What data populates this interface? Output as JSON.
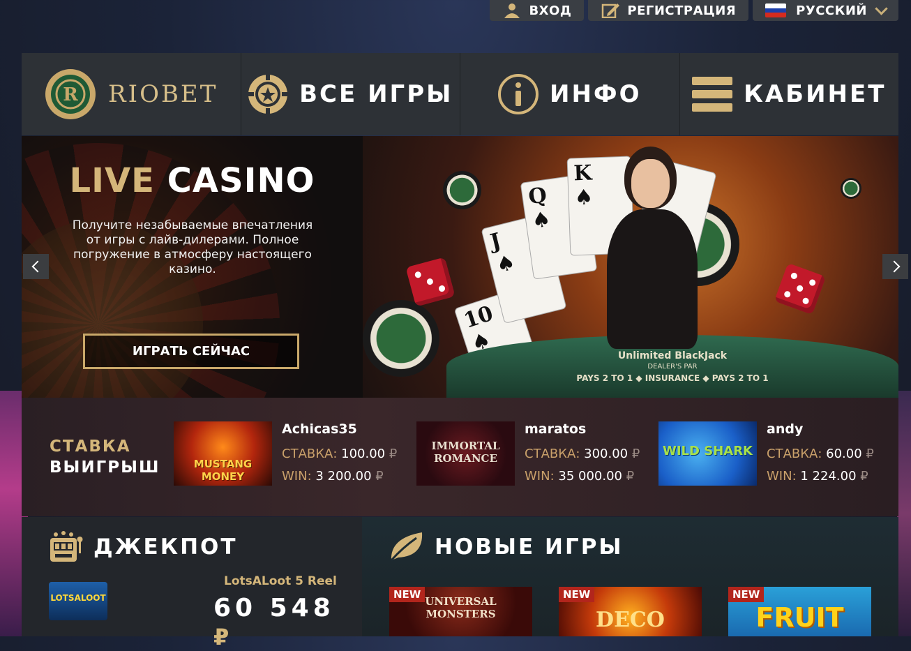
{
  "topbar": {
    "login_label": "ВХОД",
    "register_label": "РЕГИСТРАЦИЯ",
    "language_label": "РУССКИЙ"
  },
  "nav": {
    "logo_text": "RIOBET",
    "items": [
      {
        "label": "ВСЕ ИГРЫ",
        "icon": "chip-icon"
      },
      {
        "label": "ИНФО",
        "icon": "info-icon"
      },
      {
        "label": "КАБИНЕТ",
        "icon": "menu-icon"
      }
    ]
  },
  "hero": {
    "title_gold": "LIVE",
    "title_white": "CASINO",
    "description": "Получите незабываемые впечатления от игры с лайв-дилерами. Полное погружение в атмосферу настоящего казино.",
    "cta_label": "ИГРАТЬ СЕЙЧАС",
    "table_text": "Unlimited BlackJack",
    "dealer_text": "DEALER'S PAR",
    "insurance_text": "PAYS 2 TO 1 ◆ INSURANCE ◆ PAYS 2 TO 1"
  },
  "bets": {
    "label_bet": "СТАВКА",
    "label_win": "ВЫИГРЫШ",
    "items": [
      {
        "user": "Achicas35",
        "game": "MUSTANG MONEY",
        "bet_key": "СТАВКА:",
        "bet_value": "100.00",
        "win_key": "WIN:",
        "win_value": "3 200.00",
        "currency": "₽"
      },
      {
        "user": "maratos",
        "game": "IMMORTAL ROMANCE",
        "bet_key": "СТАВКА:",
        "bet_value": "300.00",
        "win_key": "WIN:",
        "win_value": "35 000.00",
        "currency": "₽"
      },
      {
        "user": "andy",
        "game": "WILD SHARK",
        "bet_key": "СТАВКА:",
        "bet_value": "60.00",
        "win_key": "WIN:",
        "win_value": "1 224.00",
        "currency": "₽"
      }
    ]
  },
  "jackpot": {
    "title": "ДЖЕКПОТ",
    "game_name": "LotsALoot 5 Reel",
    "amount": "60 548",
    "currency": "₽",
    "thumb_text": "LOTSALOOT"
  },
  "new_games": {
    "title": "НОВЫЕ ИГРЫ",
    "items": [
      {
        "badge": "NEW",
        "name": "UNIVERSAL MONSTERS"
      },
      {
        "badge": "NEW",
        "name": "DECO"
      },
      {
        "badge": "NEW",
        "name": "FRUIT"
      }
    ]
  },
  "colors": {
    "gold": "#d4b67a",
    "nav_bg": "#2d3136",
    "badge_red": "#b2251c"
  }
}
